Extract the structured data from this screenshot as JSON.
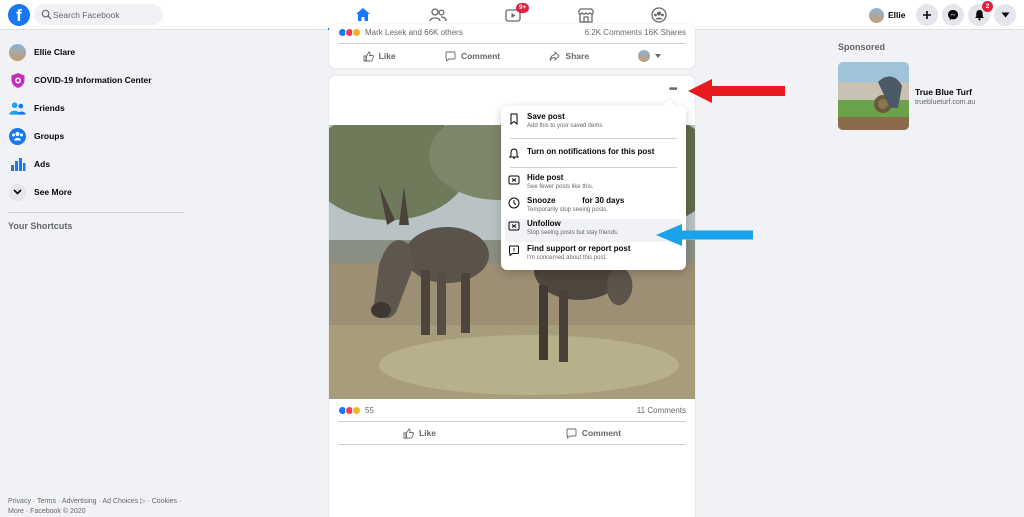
{
  "topbar": {
    "logo": "f",
    "search_placeholder": "Search Facebook",
    "video_badge": "9+",
    "profile_name": "Ellie",
    "notifications_badge": "2"
  },
  "left_nav": {
    "items": [
      {
        "label": "Ellie Clare"
      },
      {
        "label": "COVID-19 Information Center"
      },
      {
        "label": "Friends"
      },
      {
        "label": "Groups"
      },
      {
        "label": "Ads"
      },
      {
        "label": "See More"
      }
    ],
    "shortcuts_heading": "Your Shortcuts",
    "footer_line1": "Privacy · Terms · Advertising · Ad Choices ▷ · Cookies ·",
    "footer_line2": "More · Facebook © 2020"
  },
  "post1": {
    "reactions_text": "Mark Lesek and 66K others",
    "stats": "6.2K Comments  16K Shares",
    "like_label": "Like",
    "comment_label": "Comment",
    "share_label": "Share"
  },
  "post2": {
    "reaction_count": "55",
    "comments_count": "11 Comments",
    "like_label": "Like",
    "comment_label": "Comment"
  },
  "menu": {
    "items": [
      {
        "title": "Save post",
        "sub": "Add this to your saved items"
      },
      {
        "title": "Turn on notifications for this post",
        "sub": ""
      },
      {
        "title": "Hide post",
        "sub": "See fewer posts like this."
      },
      {
        "title": "Snooze            for 30 days",
        "sub": "Temporarily stop seeing posts."
      },
      {
        "title": "Unfollow",
        "sub": "Stop seeing posts but stay friends."
      },
      {
        "title": "Find support or report post",
        "sub": "I'm concerned about this post."
      }
    ]
  },
  "right": {
    "sponsored_heading": "Sponsored",
    "ad_title": "True Blue Turf",
    "ad_url": "trueblueturf.com.au"
  },
  "colors": {
    "brand_blue": "#1877f2",
    "badge_red": "#e41e3f",
    "red_arrow": "#e8191f",
    "blue_arrow": "#1aa3e8"
  }
}
